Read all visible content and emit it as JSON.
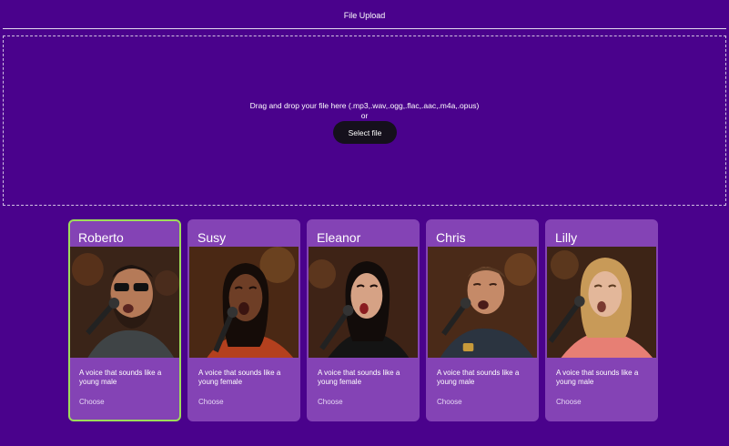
{
  "header": {
    "title": "File Upload"
  },
  "dropzone": {
    "instruction": "Drag and drop your file here (.mp3,.wav,.ogg,.flac,.aac,.m4a,.opus)",
    "or_text": "or",
    "select_label": "Select file"
  },
  "colors": {
    "background": "#4a028c",
    "card": "#8443b5",
    "selected_border": "#9edc5a",
    "button": "#15101c"
  },
  "voices": [
    {
      "name": "Roberto",
      "description": "A voice that sounds like a young male",
      "choose_label": "Choose",
      "selected": true
    },
    {
      "name": "Susy",
      "description": "A voice that sounds like a young female",
      "choose_label": "Choose",
      "selected": false
    },
    {
      "name": "Eleanor",
      "description": "A voice that sounds like a young female",
      "choose_label": "Choose",
      "selected": false
    },
    {
      "name": "Chris",
      "description": "A voice that sounds like a young male",
      "choose_label": "Choose",
      "selected": false
    },
    {
      "name": "Lilly",
      "description": "A voice that sounds like a young male",
      "choose_label": "Choose",
      "selected": false
    }
  ]
}
